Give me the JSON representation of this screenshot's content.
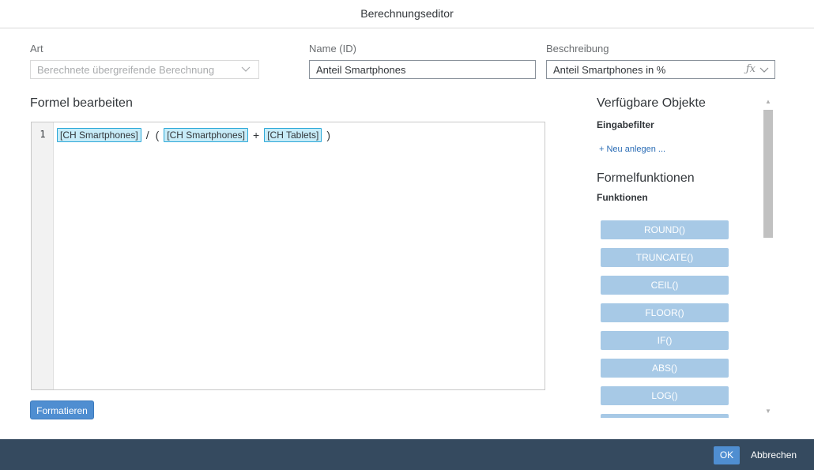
{
  "dialog": {
    "title": "Berechnungseditor"
  },
  "fields": {
    "art_label": "Art",
    "art_value": "Berechnete übergreifende Berechnung",
    "name_label": "Name (ID)",
    "name_value": "Anteil Smartphones",
    "desc_label": "Beschreibung",
    "desc_value": "Anteil Smartphones in %",
    "desc_fx": "ƒx"
  },
  "editor": {
    "title": "Formel bearbeiten",
    "line_number": "1",
    "tokens": {
      "t1": "[CH Smartphones]",
      "op1": "/",
      "op2": "(",
      "t2": "[CH Smartphones]",
      "op3": "+",
      "t3": "[CH Tablets]",
      "op4": ")"
    },
    "format_button": "Formatieren"
  },
  "sidebar": {
    "objects_title": "Verfügbare Objekte",
    "input_filter_title": "Eingabefilter",
    "new_link": "+ Neu anlegen ...",
    "functions_section_title": "Formelfunktionen",
    "functions_subtitle": "Funktionen",
    "functions": [
      "ROUND()",
      "TRUNCATE()",
      "CEIL()",
      "FLOOR()",
      "IF()",
      "ABS()",
      "LOG()"
    ]
  },
  "footer": {
    "ok_label": "OK",
    "cancel_label": "Abbrechen"
  },
  "colors": {
    "accent": "#4f8ed1",
    "function_button": "#a7c9e6",
    "token_bg": "#c7ecf8",
    "token_border": "#2ca8d8",
    "footer_bg": "#354a5f"
  },
  "icons": {
    "art_dropdown": "chevron-down-icon",
    "desc_dropdown": "chevron-down-icon",
    "scroll_up": "triangle-up-icon",
    "scroll_down": "triangle-down-icon"
  }
}
